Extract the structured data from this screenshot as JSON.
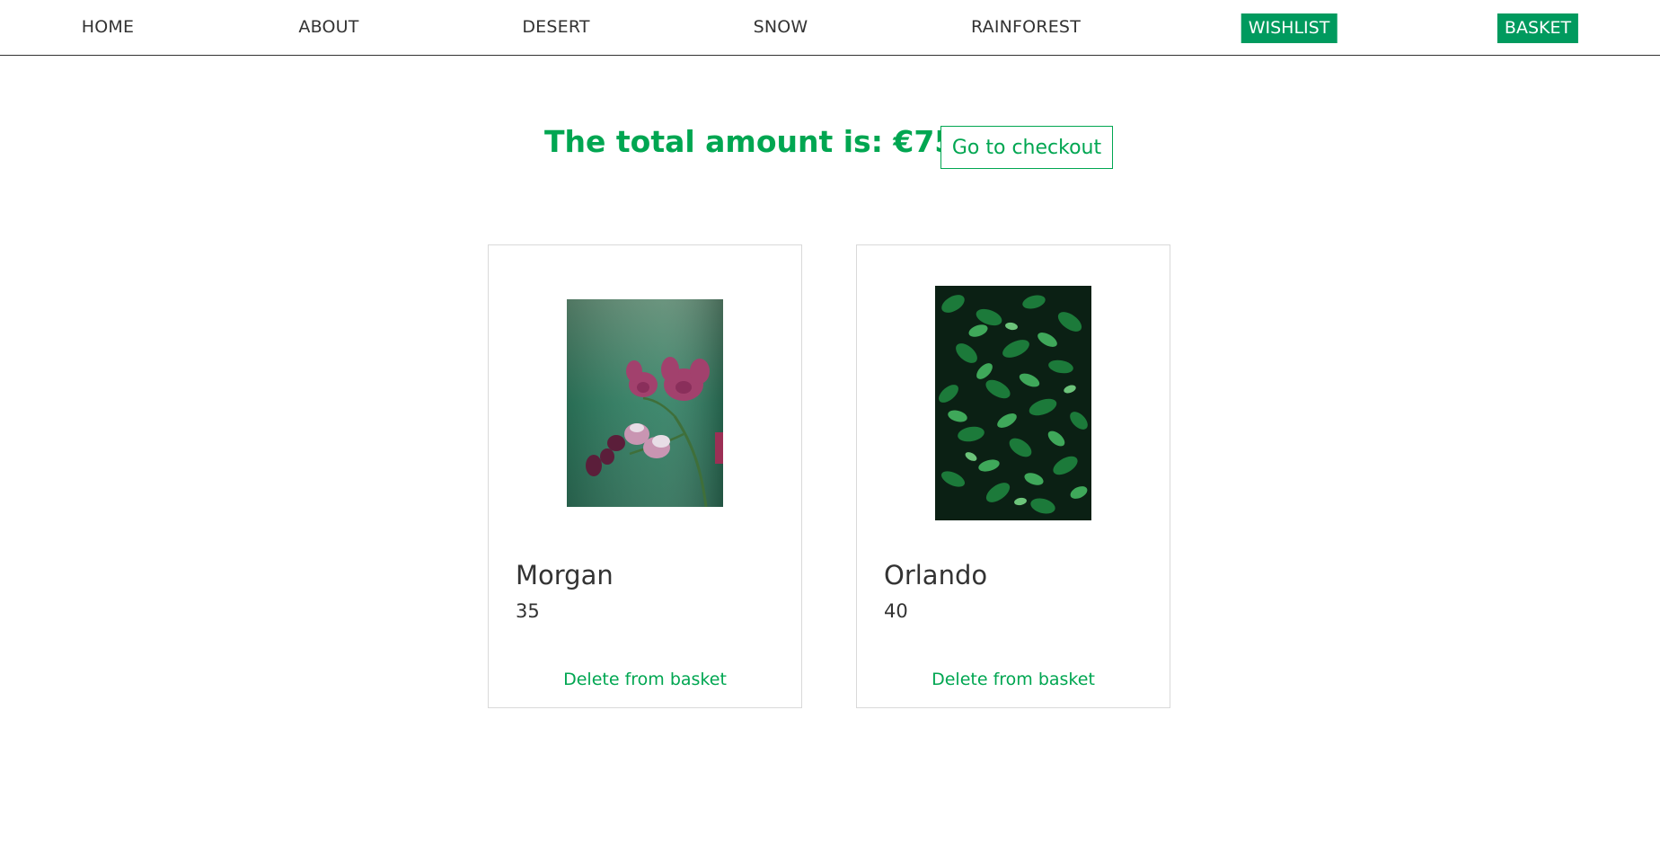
{
  "nav": {
    "home": "HOME",
    "about": "ABOUT",
    "desert": "DESERT",
    "snow": "SNOW",
    "rainforest": "RAINFOREST",
    "wishlist": "WISHLIST",
    "basket": "BASKET"
  },
  "summary": {
    "total_text": "The total amount is: €75",
    "checkout_label": "Go to checkout"
  },
  "basket": {
    "items": [
      {
        "name": "Morgan",
        "price": "35",
        "delete_label": "Delete from basket",
        "image": "orchid-photo"
      },
      {
        "name": "Orlando",
        "price": "40",
        "delete_label": "Delete from basket",
        "image": "ivy-leaves-photo"
      }
    ]
  },
  "colors": {
    "accent": "#00a651",
    "pill": "#009a5e",
    "text": "#333333",
    "card_border": "#d9d9d9"
  }
}
